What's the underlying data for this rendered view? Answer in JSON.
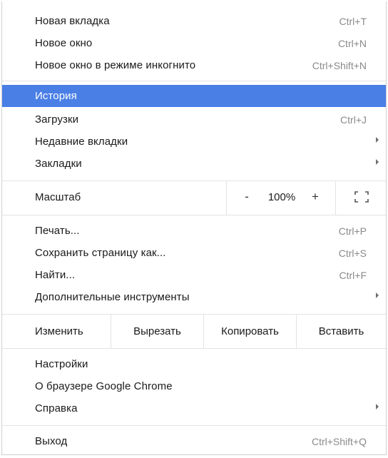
{
  "menu": {
    "new_tab": {
      "label": "Новая вкладка",
      "shortcut": "Ctrl+T"
    },
    "new_window": {
      "label": "Новое окно",
      "shortcut": "Ctrl+N"
    },
    "incognito": {
      "label": "Новое окно в режиме инкогнито",
      "shortcut": "Ctrl+Shift+N"
    },
    "history": {
      "label": "История"
    },
    "downloads": {
      "label": "Загрузки",
      "shortcut": "Ctrl+J"
    },
    "recent_tabs": {
      "label": "Недавние вкладки"
    },
    "bookmarks": {
      "label": "Закладки"
    },
    "zoom": {
      "label": "Масштаб",
      "minus": "-",
      "value": "100%",
      "plus": "+"
    },
    "print": {
      "label": "Печать...",
      "shortcut": "Ctrl+P"
    },
    "save_page": {
      "label": "Сохранить страницу как...",
      "shortcut": "Ctrl+S"
    },
    "find": {
      "label": "Найти...",
      "shortcut": "Ctrl+F"
    },
    "more_tools": {
      "label": "Дополнительные инструменты"
    },
    "edit": {
      "label": "Изменить",
      "cut": "Вырезать",
      "copy": "Копировать",
      "paste": "Вставить"
    },
    "settings": {
      "label": "Настройки"
    },
    "about": {
      "label": "О браузере Google Chrome"
    },
    "help": {
      "label": "Справка"
    },
    "exit": {
      "label": "Выход",
      "shortcut": "Ctrl+Shift+Q"
    }
  },
  "colors": {
    "highlight": "#4a7fe6",
    "shortcut_text": "#8a8a8a",
    "separator": "#e3e3e3"
  }
}
